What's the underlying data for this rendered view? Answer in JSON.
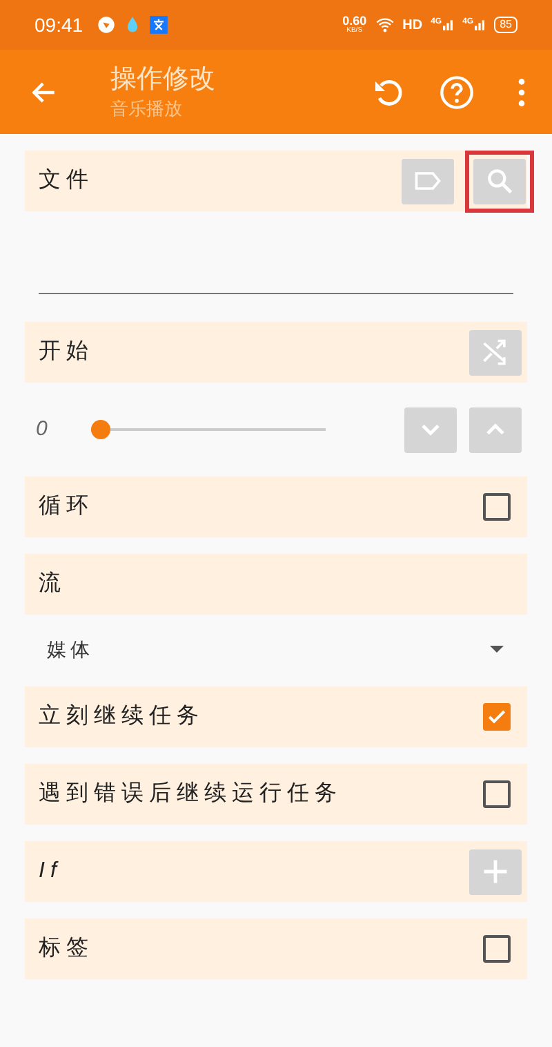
{
  "status_bar": {
    "time": "09:41",
    "speed": "0.60",
    "speed_unit": "KB/S",
    "hd": "HD",
    "net_1": "4G",
    "net_2": "4G",
    "battery": "85"
  },
  "app_bar": {
    "title": "操作修改",
    "subtitle": "音乐播放"
  },
  "items": [
    {
      "kind": "file",
      "label": "文件",
      "search_highlighted": true
    },
    {
      "kind": "text_input"
    },
    {
      "kind": "shuffle",
      "label": "开始"
    },
    {
      "kind": "slider",
      "value": "0",
      "level": 0
    },
    {
      "kind": "checkbox",
      "label": "循环",
      "checked": false
    },
    {
      "kind": "section",
      "label": "流"
    },
    {
      "kind": "dropdown",
      "value": "媒体"
    },
    {
      "kind": "checkbox",
      "label": "立刻继续任务",
      "checked": true
    },
    {
      "kind": "checkbox",
      "label": "遇到错误后继续运行任务",
      "checked": false
    },
    {
      "kind": "add",
      "label": "If"
    },
    {
      "kind": "checkbox",
      "label": "标签",
      "checked": false
    }
  ]
}
